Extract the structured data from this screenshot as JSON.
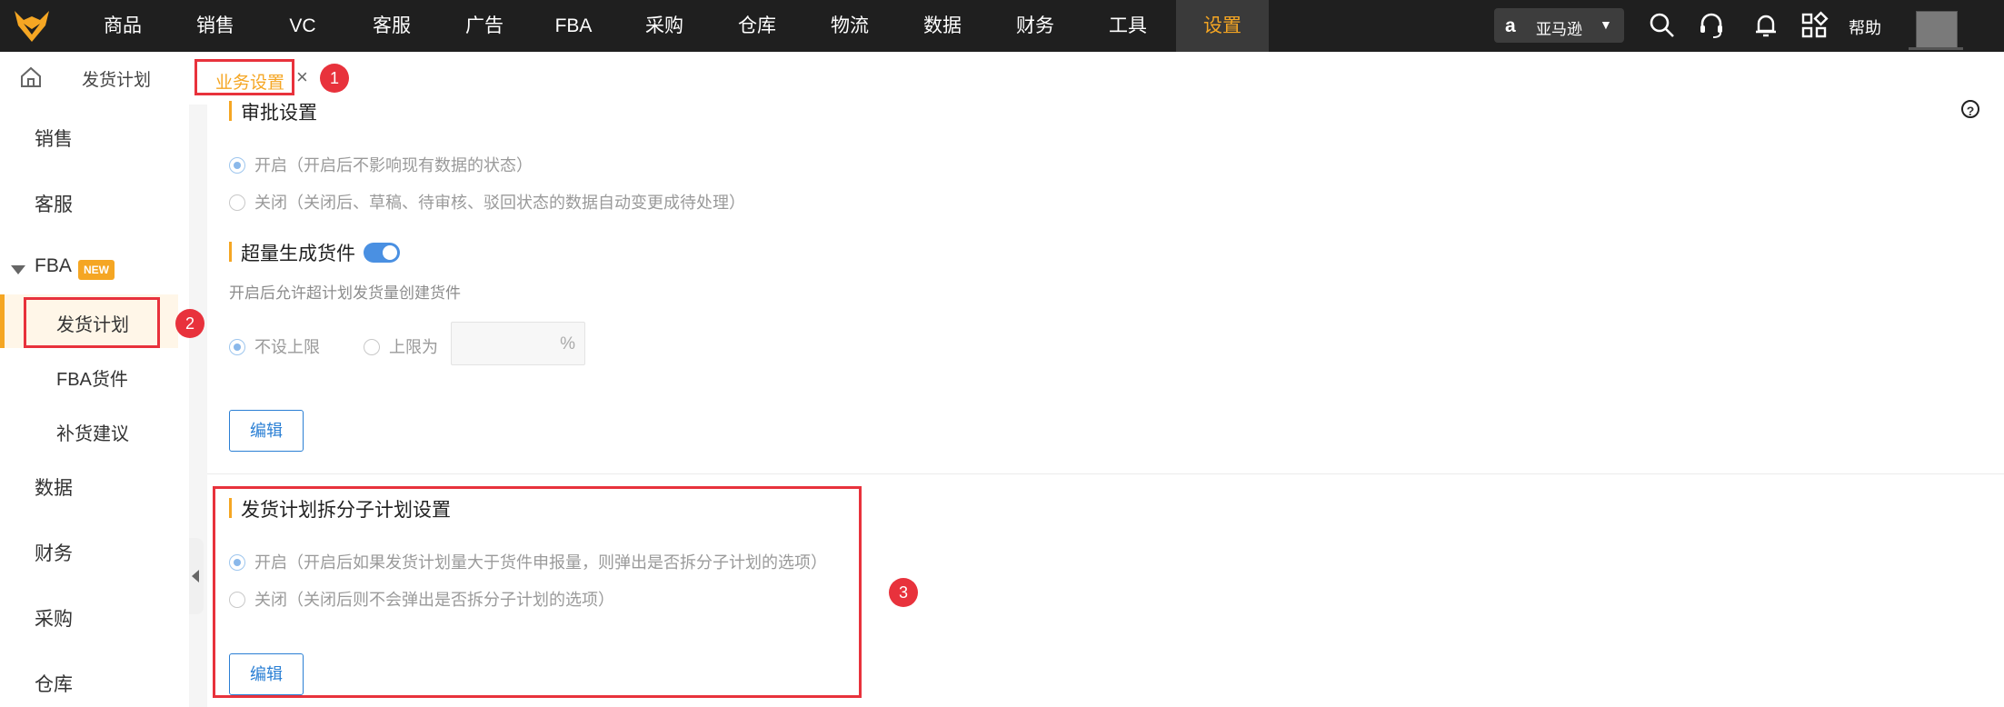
{
  "topnav": {
    "items": [
      "商品",
      "销售",
      "VC",
      "客服",
      "广告",
      "FBA",
      "采购",
      "仓库",
      "物流",
      "数据",
      "财务",
      "工具",
      "设置"
    ],
    "active": "设置",
    "marketplace": "亚马逊",
    "marketplace_icon": "amazon-logo-icon",
    "help": "帮助"
  },
  "tabs": {
    "home_icon": "home-icon",
    "items": [
      "发货计划",
      "业务设置"
    ],
    "active": "业务设置",
    "close": "×"
  },
  "markers": [
    "1",
    "2",
    "3"
  ],
  "sidebar": {
    "items": [
      "销售",
      "客服",
      "FBA",
      "数据",
      "财务",
      "采购",
      "仓库"
    ],
    "fba_badge": "NEW",
    "fba_children": [
      "发货计划",
      "FBA货件",
      "补货建议"
    ],
    "active": "发货计划"
  },
  "sections": {
    "approval": {
      "title": "审批设置",
      "options": [
        "开启（开启后不影响现有数据的状态）",
        "关闭（关闭后、草稿、待审核、驳回状态的数据自动变更成待处理）"
      ],
      "selected": 0
    },
    "oversize": {
      "title": "超量生成货件",
      "toggle_on": true,
      "description": "开启后允许超计划发货量创建货件",
      "options": [
        "不设上限",
        "上限为"
      ],
      "selected": 0,
      "limit_value": "",
      "limit_unit": "%",
      "edit_label": "编辑"
    },
    "split": {
      "title": "发货计划拆分子计划设置",
      "options": [
        "开启（开启后如果发货计划量大于货件申报量，则弹出是否拆分子计划的选项）",
        "关闭（关闭后则不会弹出是否拆分子计划的选项）"
      ],
      "selected": 0,
      "edit_label": "编辑"
    }
  },
  "help_icon_label": "?",
  "colors": {
    "accent": "#f5a623",
    "link": "#2a7fd4",
    "highlight": "#e8323c"
  }
}
